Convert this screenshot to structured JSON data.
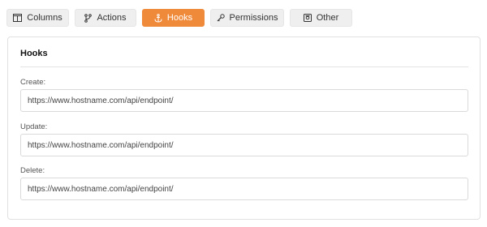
{
  "tabs": [
    {
      "label": "Columns",
      "icon": "columns-icon"
    },
    {
      "label": "Actions",
      "icon": "branch-icon"
    },
    {
      "label": "Hooks",
      "icon": "anchor-icon"
    },
    {
      "label": "Permissions",
      "icon": "key-icon"
    },
    {
      "label": "Other",
      "icon": "settings-box-icon"
    }
  ],
  "active_tab": "Hooks",
  "colors": {
    "accent": "#ef8a3b",
    "tab_bg": "#efefef"
  },
  "panel": {
    "title": "Hooks",
    "fields": [
      {
        "label": "Create:",
        "value": "https://www.hostname.com/api/endpoint/"
      },
      {
        "label": "Update:",
        "value": "https://www.hostname.com/api/endpoint/"
      },
      {
        "label": "Delete:",
        "value": "https://www.hostname.com/api/endpoint/"
      }
    ]
  }
}
